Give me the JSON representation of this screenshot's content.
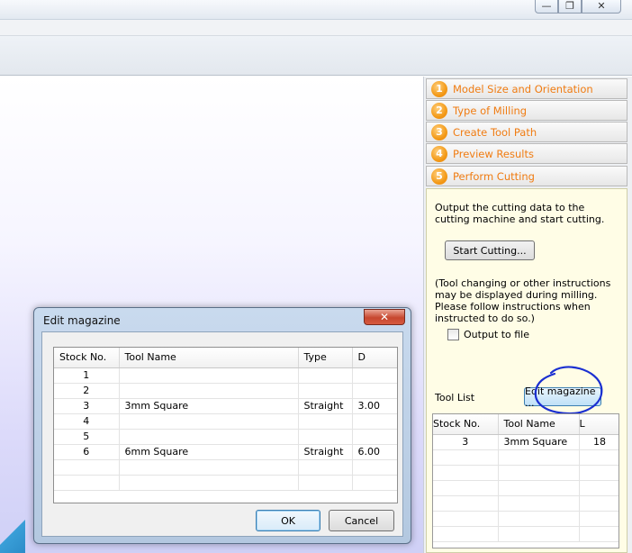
{
  "window_controls": {
    "minimize": "—",
    "restore": "❐",
    "close": "✕"
  },
  "steps": [
    {
      "num": "1",
      "label": "Model Size and Orientation"
    },
    {
      "num": "2",
      "label": "Type of Milling"
    },
    {
      "num": "3",
      "label": "Create Tool Path"
    },
    {
      "num": "4",
      "label": "Preview Results"
    },
    {
      "num": "5",
      "label": "Perform Cutting"
    }
  ],
  "panel": {
    "description": "Output the cutting data to the cutting machine and start cutting.",
    "start_button": "Start Cutting...",
    "note": "(Tool changing or other instructions may be displayed during milling. Please follow instructions when instructed to do so.)",
    "output_to_file": "Output to file",
    "tool_list_label": "Tool List",
    "edit_magazine_button": "Edit magazine ...",
    "tool_table": {
      "headers": [
        "Stock No.",
        "Tool Name",
        "L"
      ],
      "rows": [
        [
          "3",
          "3mm Square",
          "18"
        ],
        [
          "",
          "",
          ""
        ],
        [
          "",
          "",
          ""
        ],
        [
          "",
          "",
          ""
        ],
        [
          "",
          "",
          ""
        ],
        [
          "",
          "",
          ""
        ],
        [
          "",
          "",
          ""
        ]
      ]
    }
  },
  "dialog": {
    "title": "Edit magazine",
    "close": "✕",
    "table": {
      "headers": [
        "Stock No.",
        "Tool Name",
        "Type",
        "D"
      ],
      "rows": [
        [
          "1",
          "",
          "",
          ""
        ],
        [
          "2",
          "",
          "",
          ""
        ],
        [
          "3",
          "3mm Square",
          "Straight",
          "3.00"
        ],
        [
          "4",
          "",
          "",
          ""
        ],
        [
          "5",
          "",
          "",
          ""
        ],
        [
          "6",
          "6mm Square",
          "Straight",
          "6.00"
        ],
        [
          "",
          "",
          "",
          ""
        ],
        [
          "",
          "",
          "",
          ""
        ]
      ]
    },
    "ok_button": "OK",
    "cancel_button": "Cancel"
  },
  "colors": {
    "step_label": "#f07c12",
    "step_pane": "#fffde6",
    "annotation_ring": "#1a2fd1"
  }
}
